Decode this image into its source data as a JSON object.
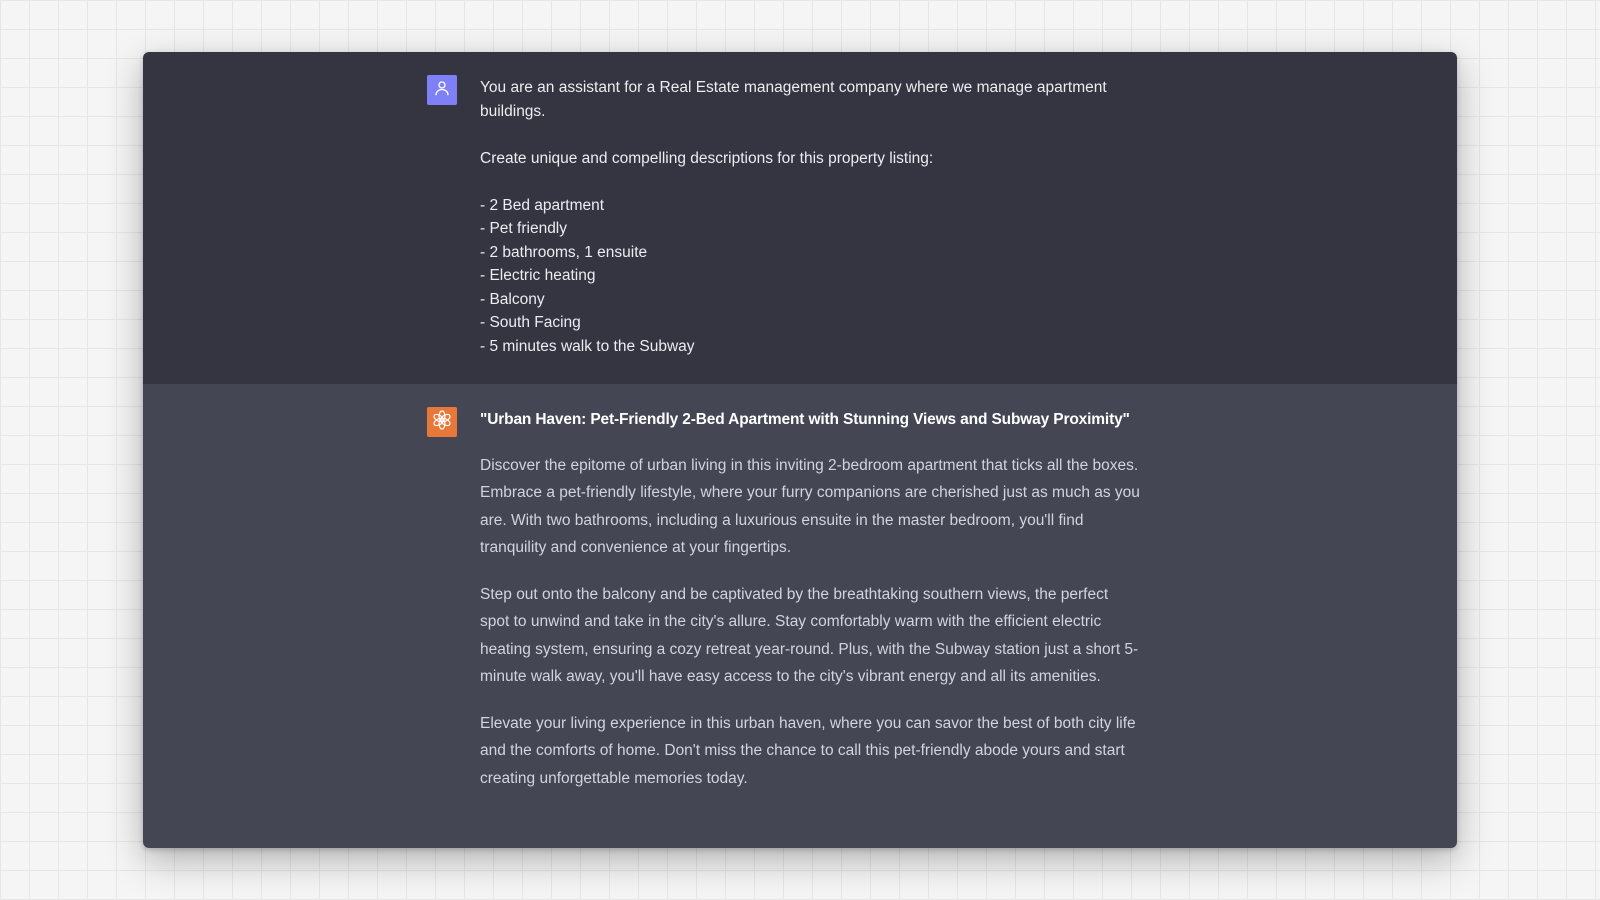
{
  "conversation": {
    "user_message": {
      "avatar_icon": "user-icon",
      "avatar_color": "#7f7ff6",
      "intro": "You are an assistant for a Real Estate management company where we manage apartment buildings.",
      "request": "Create unique and compelling descriptions for this property listing:",
      "features": [
        "- 2 Bed apartment",
        "- Pet friendly",
        "- 2 bathrooms, 1 ensuite",
        "- Electric heating",
        "- Balcony",
        "- South Facing",
        "- 5 minutes walk to the Subway"
      ]
    },
    "assistant_message": {
      "avatar_icon": "openai-logo-icon",
      "avatar_color": "#e8773a",
      "headline": "\"Urban Haven: Pet-Friendly 2-Bed Apartment with Stunning Views and Subway Proximity\"",
      "paragraphs": [
        "Discover the epitome of urban living in this inviting 2-bedroom apartment that ticks all the boxes. Embrace a pet-friendly lifestyle, where your furry companions are cherished just as much as you are. With two bathrooms, including a luxurious ensuite in the master bedroom, you'll find tranquility and convenience at your fingertips.",
        "Step out onto the balcony and be captivated by the breathtaking southern views, the perfect spot to unwind and take in the city's allure. Stay comfortably warm with the efficient electric heating system, ensuring a cozy retreat year-round. Plus, with the Subway station just a short 5-minute walk away, you'll have easy access to the city's vibrant energy and all its amenities.",
        "Elevate your living experience in this urban haven, where you can savor the best of both city life and the comforts of home. Don't miss the chance to call this pet-friendly abode yours and start creating unforgettable memories today."
      ]
    }
  },
  "colors": {
    "page_background": "#f5f5f5",
    "user_row_background": "#343541",
    "assistant_row_background": "#444654",
    "user_text": "#ececf1",
    "assistant_text": "#d1d5db"
  }
}
